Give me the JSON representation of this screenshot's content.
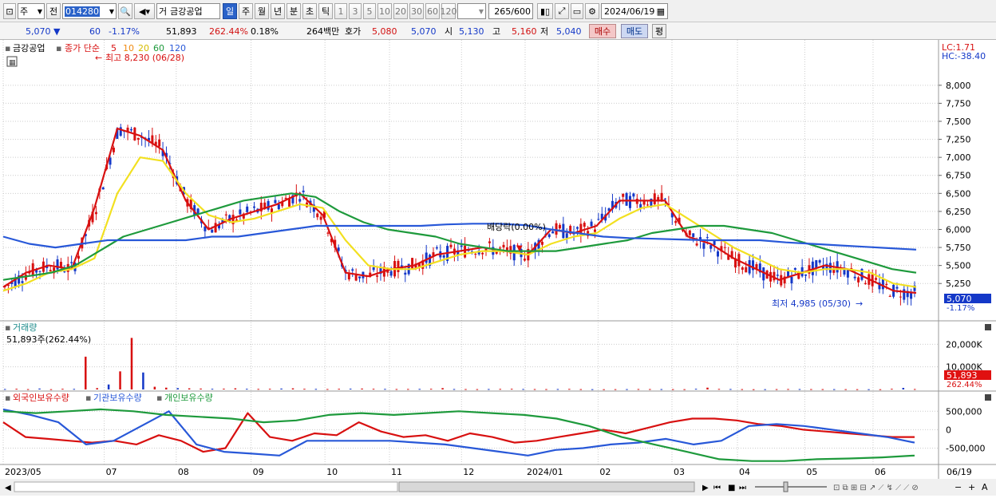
{
  "toolbar": {
    "market_mode": "주",
    "prev_label": "전",
    "stock_code": "014280",
    "stock_type": "거",
    "stock_name": "금강공업",
    "period_day": "일",
    "period_week": "주",
    "period_month": "월",
    "period_year": "년",
    "period_minute": "분",
    "period_second": "초",
    "period_tick": "틱",
    "intervals": [
      "1",
      "3",
      "5",
      "10",
      "20",
      "30",
      "60",
      "120"
    ],
    "count_shown": "265",
    "count_total": "/600",
    "date": "2024/06/19"
  },
  "quote": {
    "price": "5,070",
    "change_arrow": "▼",
    "change": "60",
    "change_pct": "-1.17%",
    "volume": "51,893",
    "volume_ratio": "262.44%",
    "turnover": "0.18%",
    "trade_amount": "264백만",
    "ask_label": "호가",
    "ask": "5,080",
    "bid": "5,070",
    "open_label": "시",
    "open": "5,130",
    "high_label": "고",
    "high": "5,160",
    "low_label": "저",
    "low": "5,040",
    "buy_label": "매수",
    "sell_label": "매도",
    "flat_label": "평"
  },
  "price_panel": {
    "stock_name": "금강공업",
    "ma_label": "종가 단순",
    "ma_periods": [
      {
        "p": "5",
        "color": "#d81010"
      },
      {
        "p": "10",
        "color": "#f08a10"
      },
      {
        "p": "20",
        "color": "#e2c800"
      },
      {
        "p": "60",
        "color": "#1e9a3c"
      },
      {
        "p": "120",
        "color": "#2858d8"
      }
    ],
    "max_label": "최고 8,230 (06/28)",
    "min_label": "최저 4,985 (05/30)",
    "dividend_label": "배당락(0.00%)",
    "lc_label": "LC:1.71",
    "hc_label": "HC:-38.40",
    "current_price": "5,070",
    "current_change_pct": "-1.17%"
  },
  "volume_panel": {
    "title": "거래량",
    "value_label": "51,893주(262.44%)",
    "current": "51,893",
    "current_pct": "262.44%"
  },
  "holdings_panel": {
    "foreign_label": "외국인보유수량",
    "inst_label": "기관보유수량",
    "indiv_label": "개인보유수량"
  },
  "colors": {
    "up": "#d81010",
    "down": "#1438c8",
    "ma5": "#d81010",
    "ma10": "#f08a10",
    "ma20": "#f2e020",
    "ma60": "#1e9a3c",
    "ma120": "#2858d8"
  },
  "chart_data": [
    {
      "type": "line",
      "title": "금강공업",
      "ylim": [
        4985,
        8230
      ],
      "y_ticks": [
        "8,000",
        "7,750",
        "7,500",
        "7,250",
        "7,000",
        "6,750",
        "6,500",
        "6,250",
        "6,000",
        "5,750",
        "5,500",
        "5,250"
      ],
      "y_tick_values": [
        8000,
        7750,
        7500,
        7250,
        7000,
        6750,
        6500,
        6250,
        6000,
        5750,
        5500,
        5250
      ],
      "x_ticks": [
        "2023/05",
        "07",
        "08",
        "09",
        "10",
        "11",
        "12",
        "2024/01",
        "02",
        "03",
        "04",
        "05",
        "06",
        "06/19"
      ],
      "series": [
        {
          "name": "5",
          "values": [
            5200,
            5400,
            5500,
            5450,
            6300,
            7400,
            7300,
            7100,
            6400,
            6000,
            6150,
            6250,
            6350,
            6500,
            6200,
            5400,
            5350,
            5450,
            5500,
            5650,
            5700,
            5750,
            5700,
            5650,
            6000,
            5950,
            6050,
            6400,
            6400,
            6400,
            5900,
            5800,
            5600,
            5450,
            5300,
            5400,
            5500,
            5450,
            5300,
            5150,
            5120
          ]
        },
        {
          "name": "20",
          "values": [
            5150,
            5250,
            5400,
            5450,
            5600,
            6500,
            7000,
            6950,
            6500,
            6200,
            6100,
            6150,
            6250,
            6350,
            6300,
            5850,
            5500,
            5450,
            5450,
            5550,
            5650,
            5700,
            5700,
            5650,
            5800,
            5900,
            5950,
            6150,
            6300,
            6350,
            6150,
            5950,
            5750,
            5600,
            5450,
            5400,
            5450,
            5450,
            5400,
            5250,
            5200
          ]
        },
        {
          "name": "60",
          "values": [
            5300,
            5350,
            5400,
            5500,
            5700,
            5900,
            6000,
            6100,
            6200,
            6300,
            6400,
            6450,
            6500,
            6450,
            6250,
            6100,
            6000,
            5950,
            5900,
            5800,
            5750,
            5700,
            5700,
            5700,
            5750,
            5800,
            5850,
            5950,
            6000,
            6050,
            6050,
            6000,
            5950,
            5850,
            5750,
            5650,
            5550,
            5450,
            5400
          ]
        },
        {
          "name": "120",
          "values": [
            5900,
            5800,
            5750,
            5800,
            5850,
            5850,
            5850,
            5850,
            5900,
            5900,
            5950,
            6000,
            6050,
            6050,
            6050,
            6050,
            6050,
            6070,
            6080,
            6080,
            6060,
            6000,
            5950,
            5900,
            5880,
            5870,
            5860,
            5850,
            5850,
            5850,
            5820,
            5800,
            5780,
            5760,
            5740,
            5720
          ]
        }
      ]
    },
    {
      "type": "bar",
      "title": "거래량",
      "y_ticks": [
        "20,000K",
        "10,000K"
      ],
      "y_tick_values": [
        20000,
        10000
      ],
      "ylim": [
        0,
        24000
      ],
      "values_k": [
        200,
        300,
        150,
        400,
        120,
        300,
        250,
        14500,
        600,
        2200,
        8000,
        22800,
        7500,
        1200,
        800,
        600,
        500,
        400,
        300,
        350,
        500,
        300,
        250,
        300,
        400,
        500,
        300,
        250,
        200,
        300,
        350,
        400,
        300,
        250,
        200,
        220,
        250,
        300,
        600,
        200,
        180,
        150,
        200,
        250,
        300,
        200,
        180,
        160,
        200,
        250,
        150,
        120,
        100,
        130,
        150,
        200,
        180,
        160,
        140,
        120,
        300,
        800,
        250,
        200,
        150,
        100,
        120,
        150,
        200,
        180,
        160,
        150,
        140,
        130,
        120,
        110,
        100,
        300,
        700,
        200
      ]
    },
    {
      "type": "line",
      "title": "보유수량",
      "y_ticks": [
        "500,000",
        "0",
        "-500,000"
      ],
      "y_tick_values": [
        500000,
        0,
        -500000
      ],
      "ylim": [
        -900000,
        700000
      ],
      "series": [
        {
          "name": "외국인보유수량",
          "values": [
            200000,
            -200000,
            -250000,
            -300000,
            -350000,
            -300000,
            -400000,
            -150000,
            -300000,
            -600000,
            -500000,
            450000,
            -200000,
            -300000,
            -100000,
            -150000,
            200000,
            -50000,
            -200000,
            -150000,
            -300000,
            -100000,
            -200000,
            -350000,
            -300000,
            -200000,
            -100000,
            0,
            -100000,
            50000,
            200000,
            300000,
            300000,
            250000,
            150000,
            100000,
            0,
            -50000,
            -100000,
            -150000,
            -200000,
            -200000
          ]
        },
        {
          "name": "기관보유수량",
          "values": [
            550000,
            400000,
            200000,
            -400000,
            -300000,
            100000,
            500000,
            -400000,
            -600000,
            -650000,
            -700000,
            -300000,
            -300000,
            -300000,
            -300000,
            -350000,
            -400000,
            -500000,
            -600000,
            -700000,
            -550000,
            -500000,
            -400000,
            -350000,
            -250000,
            -400000,
            -300000,
            100000,
            150000,
            100000,
            0,
            -100000,
            -200000,
            -350000
          ]
        },
        {
          "name": "개인보유수량",
          "values": [
            500000,
            450000,
            500000,
            550000,
            500000,
            400000,
            350000,
            300000,
            200000,
            250000,
            400000,
            450000,
            400000,
            450000,
            500000,
            450000,
            400000,
            300000,
            100000,
            -200000,
            -400000,
            -600000,
            -800000,
            -850000,
            -850000,
            -800000,
            -780000,
            -750000,
            -700000
          ]
        }
      ]
    }
  ]
}
